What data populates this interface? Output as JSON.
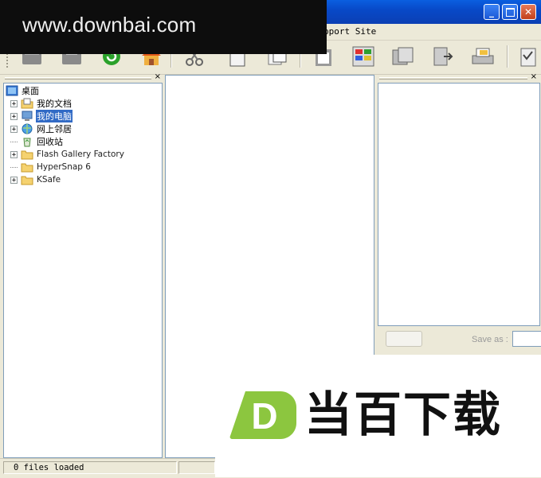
{
  "window": {
    "buttons": [
      "minimize",
      "maximize",
      "close"
    ]
  },
  "menubar": {
    "visible_item": "pport Site"
  },
  "toolbar": {
    "buttons": [
      {
        "name": "open-icon"
      },
      {
        "name": "save-icon"
      },
      {
        "name": "refresh-icon"
      },
      {
        "name": "home-icon"
      },
      {
        "name": "cut-icon"
      },
      {
        "name": "copy-icon"
      },
      {
        "name": "paste-icon"
      },
      {
        "name": "clipboard-icon"
      },
      {
        "name": "thumbnails-icon"
      },
      {
        "name": "slideshow-icon"
      },
      {
        "name": "export-icon"
      },
      {
        "name": "print-icon"
      },
      {
        "name": "more-icon"
      }
    ]
  },
  "tree": {
    "root": "桌面",
    "items": [
      {
        "label": "我的文档",
        "expandable": true,
        "icon": "documents-folder-icon"
      },
      {
        "label": "我的电脑",
        "expandable": true,
        "icon": "computer-icon",
        "selected": true
      },
      {
        "label": "网上邻居",
        "expandable": true,
        "icon": "network-icon"
      },
      {
        "label": "回收站",
        "expandable": false,
        "icon": "recycle-bin-icon"
      },
      {
        "label": "Flash Gallery Factory",
        "expandable": true,
        "icon": "folder-icon"
      },
      {
        "label": "HyperSnap 6",
        "expandable": false,
        "icon": "folder-icon"
      },
      {
        "label": "KSafe",
        "expandable": true,
        "icon": "folder-icon"
      }
    ]
  },
  "right_panel": {
    "save_as_label": "Save as :"
  },
  "statusbar": {
    "files_loaded": "0 files loaded"
  },
  "watermark": {
    "url": "www.downbai.com",
    "logo_letter": "D",
    "brand": "当百下载"
  }
}
